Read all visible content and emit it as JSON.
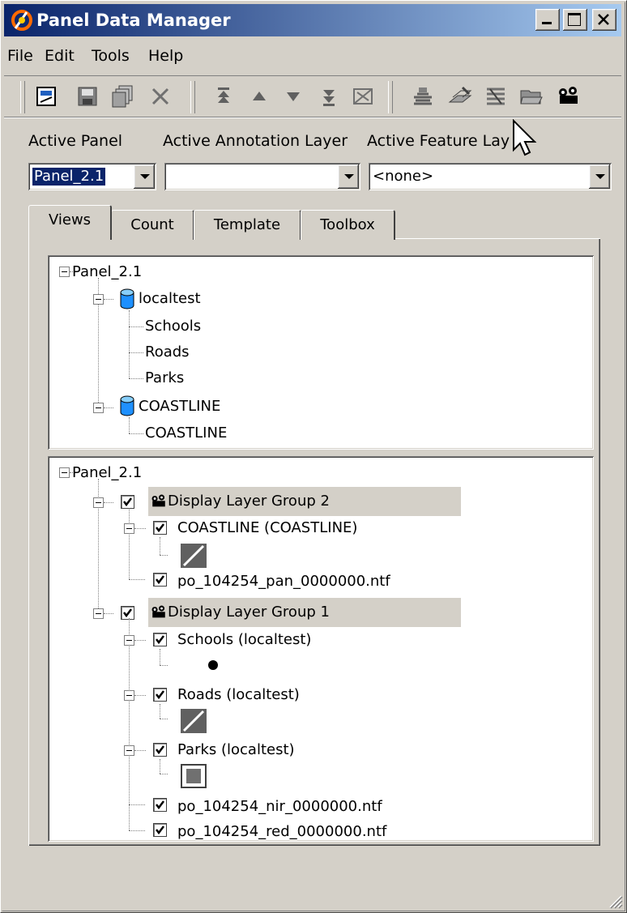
{
  "window": {
    "title": "Panel Data Manager",
    "minimize_label": "_",
    "maximize_label": "□",
    "close_label": "×"
  },
  "menu": {
    "items": [
      "File",
      "Edit",
      "Tools",
      "Help"
    ]
  },
  "toolbar": {
    "icons": [
      "new-panel-icon",
      "save-icon",
      "copy-icon",
      "delete-icon",
      "move-top-icon",
      "move-up-icon",
      "move-down-icon",
      "move-bottom-icon",
      "zoom-extent-icon",
      "layer-stack-icon",
      "layer-edit-icon",
      "layer-group-icon",
      "layer-open-icon",
      "display-group-icon"
    ]
  },
  "labels": {
    "active_panel": "Active Panel",
    "active_annotation_layer": "Active Annotation Layer",
    "active_feature_layer": "Active Feature Lay"
  },
  "combos": {
    "panel_value": "Panel_2.1",
    "annotation_value": "",
    "feature_value": "<none>"
  },
  "tabs": [
    "Views",
    "Count",
    "Template",
    "Toolbox"
  ],
  "sources_tree": {
    "root": "Panel_2.1",
    "databases": [
      {
        "name": "localtest",
        "layers": [
          "Schools",
          "Roads",
          "Parks"
        ]
      },
      {
        "name": "COASTLINE",
        "layers": [
          "COASTLINE"
        ]
      }
    ]
  },
  "display_tree": {
    "root": "Panel_2.1",
    "group2": {
      "name": "Display Layer Group 2",
      "layer": "COASTLINE (COASTLINE)",
      "image": "po_104254_pan_0000000.ntf"
    },
    "group1": {
      "name": "Display Layer Group 1",
      "layers": [
        "Schools (localtest)",
        "Roads (localtest)",
        "Parks (localtest)"
      ],
      "images": [
        "po_104254_nir_0000000.ntf",
        "po_104254_red_0000000.ntf"
      ]
    }
  },
  "colors": {
    "title_start": "#0a246a",
    "title_end": "#a6caf0",
    "face": "#d4d0c8",
    "cylinder": "#1e90ff"
  }
}
